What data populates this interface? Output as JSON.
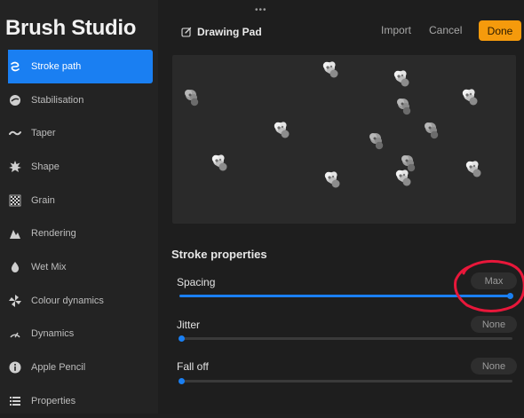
{
  "app": {
    "title": "Brush Studio"
  },
  "sidebar": {
    "items": [
      {
        "label": "Stroke path",
        "icon": "stroke-path-icon",
        "active": true
      },
      {
        "label": "Stabilisation",
        "icon": "stabilisation-icon"
      },
      {
        "label": "Taper",
        "icon": "taper-icon"
      },
      {
        "label": "Shape",
        "icon": "shape-icon"
      },
      {
        "label": "Grain",
        "icon": "grain-icon"
      },
      {
        "label": "Rendering",
        "icon": "rendering-icon"
      },
      {
        "label": "Wet Mix",
        "icon": "wet-mix-icon"
      },
      {
        "label": "Colour dynamics",
        "icon": "colour-dynamics-icon"
      },
      {
        "label": "Dynamics",
        "icon": "dynamics-icon"
      },
      {
        "label": "Apple Pencil",
        "icon": "apple-pencil-icon"
      },
      {
        "label": "Properties",
        "icon": "properties-icon"
      }
    ]
  },
  "header": {
    "grip": "•••",
    "title": "Drawing Pad",
    "import_label": "Import",
    "cancel_label": "Cancel",
    "done_label": "Done"
  },
  "stroke_properties": {
    "title": "Stroke properties",
    "spacing": {
      "label": "Spacing",
      "value": "Max",
      "fraction": 1.0
    },
    "jitter": {
      "label": "Jitter",
      "value": "None",
      "fraction": 0.0
    },
    "falloff": {
      "label": "Fall off",
      "value": "None",
      "fraction": 0.0
    }
  },
  "colors": {
    "accent": "#1a7ff2",
    "done": "#f59a0c",
    "annotation": "#e8173a"
  }
}
